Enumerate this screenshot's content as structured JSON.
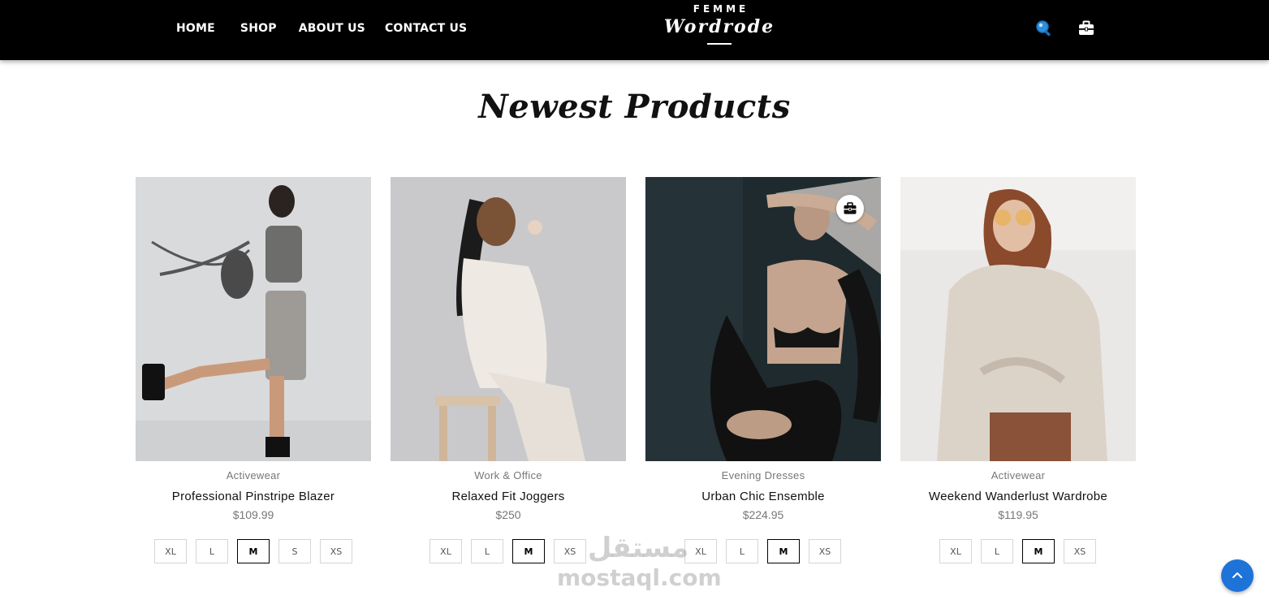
{
  "header": {
    "nav": [
      {
        "label": "HOME"
      },
      {
        "label": "SHOP"
      },
      {
        "label": "ABOUT US"
      },
      {
        "label": "CONTACT US"
      }
    ],
    "logo_top": "FEMME",
    "logo_main": "Wordrode",
    "icons": [
      "search-icon",
      "briefcase-cart-icon"
    ]
  },
  "section": {
    "title": "Newest Products"
  },
  "products": [
    {
      "category": "Activewear",
      "name": "Professional Pinstripe Blazer",
      "price": "$109.99",
      "sizes": [
        "XL",
        "L",
        "M",
        "S",
        "XS"
      ],
      "selected_size": "M"
    },
    {
      "category": "Work & Office",
      "name": "Relaxed Fit Joggers",
      "price": "$250",
      "sizes": [
        "XL",
        "L",
        "M",
        "XS"
      ],
      "selected_size": "M"
    },
    {
      "category": "Evening Dresses",
      "name": "Urban Chic Ensemble",
      "price": "$224.95",
      "sizes": [
        "XL",
        "L",
        "M",
        "XS"
      ],
      "selected_size": "M"
    },
    {
      "category": "Activewear",
      "name": "Weekend Wanderlust Wardrobe",
      "price": "$119.95",
      "sizes": [
        "XL",
        "L",
        "M",
        "XS"
      ],
      "selected_size": "M"
    }
  ],
  "watermark": {
    "arabic": "مستقل",
    "latin": "mostaql.com"
  },
  "colors": {
    "header_bg": "#000000",
    "accent": "#1e73d8",
    "muted_text": "#777777"
  }
}
